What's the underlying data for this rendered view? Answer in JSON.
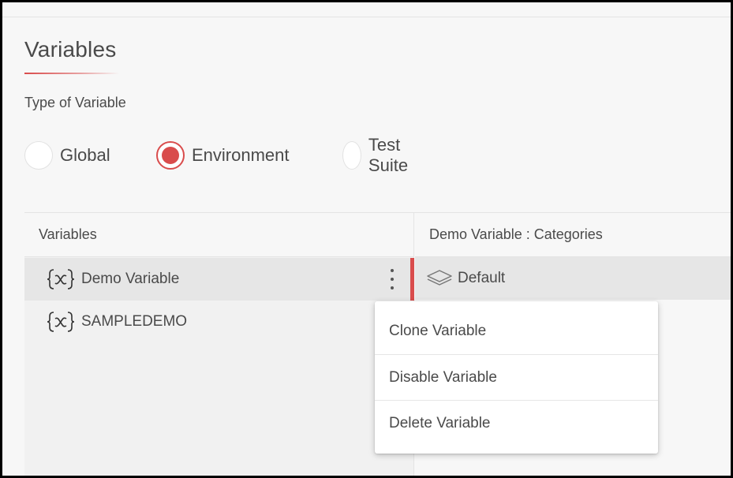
{
  "page": {
    "title": "Variables",
    "type_label": "Type of Variable"
  },
  "radio_options": [
    {
      "label": "Global",
      "checked": false
    },
    {
      "label": "Environment",
      "checked": true
    },
    {
      "label": "Test Suite",
      "checked": false
    }
  ],
  "variables_panel": {
    "header": "Variables",
    "items": [
      {
        "name": "Demo Variable",
        "icon": "curly-x-icon",
        "selected": true
      },
      {
        "name": "SAMPLEDEMO",
        "icon": "curly-x-icon",
        "selected": false
      }
    ]
  },
  "categories_panel": {
    "header": "Demo Variable : Categories",
    "items": [
      {
        "name": "Default",
        "icon": "layers-icon"
      }
    ]
  },
  "context_menu": {
    "items": [
      "Clone Variable",
      "Disable Variable",
      "Delete Variable"
    ]
  },
  "colors": {
    "accent": "#d94c4c",
    "text": "#4a4a4a",
    "background": "#f7f7f7"
  }
}
